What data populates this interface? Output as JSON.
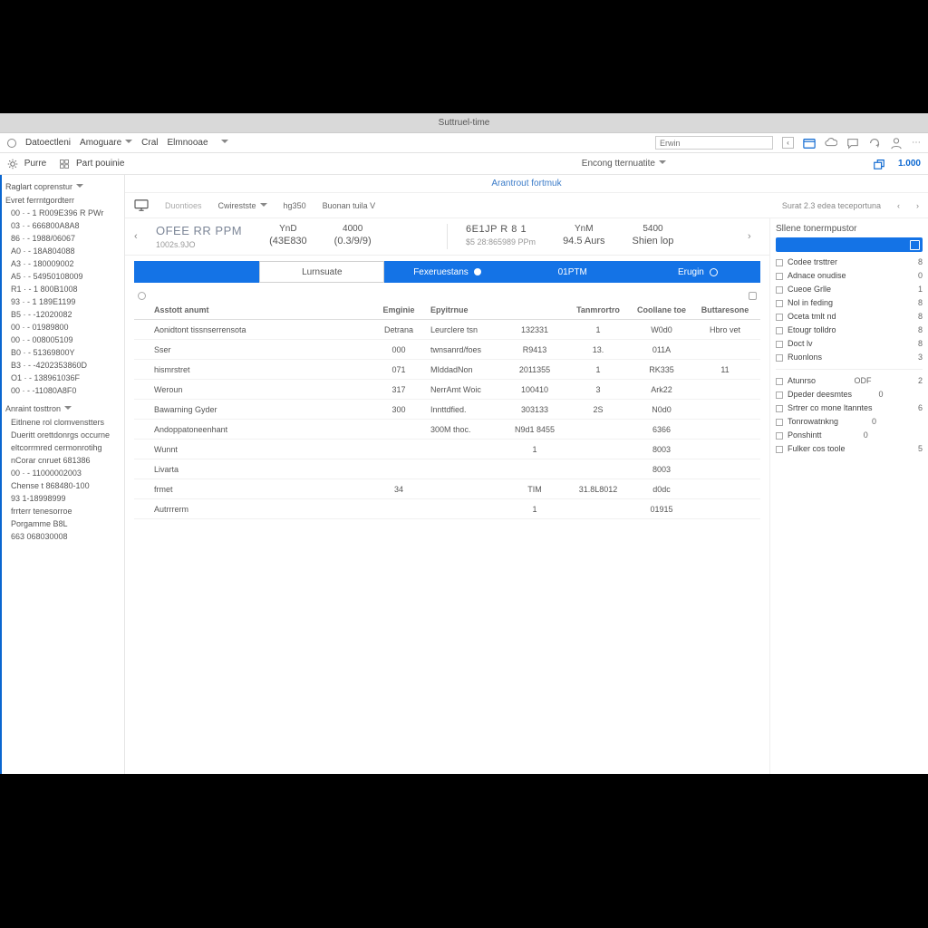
{
  "window": {
    "title": "Suttruel-time"
  },
  "menubar": {
    "items": [
      "Datoectleni",
      "Amoguare",
      "Cral",
      "Elmnooae"
    ],
    "search_placeholder": "Erwin"
  },
  "ribbon": {
    "left": [
      {
        "icon": "gear-icon",
        "label": "Purre"
      },
      {
        "icon": "grid-icon",
        "label": "Part pouinie"
      }
    ],
    "center_crumb": "Arantrout fortmuk",
    "template_label": "Encong tternuatite",
    "right_icon": "export-icon",
    "right_value": "1.000"
  },
  "sidebar": {
    "section1_title": "Raglart coprenstur",
    "tree": [
      "Evret ferrntgordterr",
      "00 · - 1 R009E396 R PWr",
      "03 · - 666800A8A8",
      "86 · - 1988/06067",
      "A0 · - 18A804088",
      "A3 · - 180009002",
      "A5 · - 54950108009",
      "R1 · - 1 800B1008",
      "93 · - 1 189E1199",
      "B5 · - -12020082",
      "00 · - 01989800",
      "00 · - 008005109",
      "B0 · - 51369800Y",
      "B3 · - -4202353860D",
      "O1 · - 138961036F",
      "00 · - -11080A8F0"
    ],
    "section2_title": "Anraint tosttron",
    "section2_items": [
      "Eitlnene rol clomvenstters",
      "Dueritt orettdonrgs occurne",
      "eltcorrmred cermonrotihg",
      "nCorar cnruet 681386",
      "00 · - 11000002003",
      "Chense t 868480-100",
      "93   1-18998999",
      "frrterr tenesorroe",
      "Porgamme B8L",
      "663 068030008"
    ]
  },
  "toolbar2": {
    "breadcrumb": "Duontioes",
    "items": [
      "Cwirestste",
      "hg350",
      "Buonan tuila   V"
    ],
    "right": "Surat 2.3 edea teceportuna"
  },
  "summary": {
    "left": {
      "title": "OFEE RR PPM",
      "sub": "1002s.9JO"
    },
    "metrics1": [
      {
        "label": "YnD",
        "value": "(43E830"
      },
      {
        "label": "4000",
        "value": "(0.3/9/9)"
      }
    ],
    "right": {
      "title": "6E1JP R 8 1",
      "sub": "$5 28:865989 PPm"
    },
    "metrics2": [
      {
        "label": "YnM",
        "value": "94.5 Aurs"
      },
      {
        "label": "5400",
        "value": "Shien lop"
      }
    ]
  },
  "tabs": [
    {
      "label": "",
      "style": "active"
    },
    {
      "label": "Lurnsuate",
      "style": "white"
    },
    {
      "label": "Fexeruestans",
      "style": "blue",
      "icon": "dot"
    },
    {
      "label": "01PTM",
      "style": "blue"
    },
    {
      "label": "Erugin",
      "style": "blue",
      "icon": "ring"
    }
  ],
  "table": {
    "columns": [
      "",
      "Asstott anumt",
      "Emginie",
      "Epyitrnue",
      "Tanmrortro",
      "Coollane toe",
      "Buttaresone"
    ],
    "rows": [
      {
        "name": "Aonidtont tissnserrensota",
        "eng": "Detrana",
        "exp": "Leurclere tsn",
        "time": "132331",
        "trm": "1",
        "cool": "W0d0",
        "bat": "Hbro vet"
      },
      {
        "name": "Sser",
        "eng": "000",
        "exp": "twnsanrd/foes",
        "time": "R9413",
        "trm": "13.",
        "cool": "011A",
        "bat": ""
      },
      {
        "name": "hismrstret",
        "eng": "071",
        "exp": "MIddadNon",
        "time": "2011355",
        "trm": "1",
        "cool": "RK335",
        "bat": "11"
      },
      {
        "name": "Weroun",
        "eng": "317",
        "exp": "NerrAmt Woic",
        "time": "100410",
        "trm": "3",
        "cool": "Ark22",
        "bat": ""
      },
      {
        "name": "Bawarning Gyder",
        "eng": "300",
        "exp": "Innttdfied.",
        "time": "303133",
        "trm": "2S",
        "cool": "N0d0",
        "bat": ""
      },
      {
        "name": "Andoppatoneenhant",
        "eng": "",
        "exp": "300M thoc.",
        "time": "N9d1 8455",
        "trm": "",
        "cool": "6366",
        "bat": ""
      },
      {
        "name": "Wunnt",
        "eng": "",
        "exp": "",
        "time": "1",
        "trm": "",
        "cool": "8003",
        "bat": ""
      },
      {
        "name": "Livarta",
        "eng": "",
        "exp": "",
        "time": "",
        "trm": "",
        "cool": "8003",
        "bat": ""
      },
      {
        "name": "frmet",
        "eng": "34",
        "exp": "",
        "time": "TIM",
        "trm": "31.8L8012",
        "cool": "d0dc",
        "bat": ""
      },
      {
        "name": "Autrrrerm",
        "eng": "",
        "exp": "",
        "time": "1",
        "trm": "",
        "cool": "01915",
        "bat": ""
      }
    ]
  },
  "rightpanel": {
    "title": "Sllene tonermpustor",
    "rows1": [
      {
        "label": "Codee trsttrer",
        "v": "8"
      },
      {
        "label": "Adnace onudise",
        "v": "0"
      },
      {
        "label": "Cueoe Grlle",
        "v": "1"
      },
      {
        "label": "Nol in feding",
        "v": "8"
      },
      {
        "label": "Oceta tmlt nd",
        "v": "8"
      },
      {
        "label": "Etougr tolldro",
        "v": "8"
      },
      {
        "label": "Doct lv",
        "v": "8"
      },
      {
        "label": "Ruonlons",
        "v": "3"
      }
    ],
    "rows2": [
      {
        "label": "Atunrso",
        "v": "ODF",
        "v2": "2"
      },
      {
        "label": "Dpeder deesmtes",
        "v": "0",
        "v2": ""
      },
      {
        "label": "Srtrer co mone ltanntes",
        "v": "",
        "v2": "6"
      },
      {
        "label": "Tonrowatnkng",
        "v": "0",
        "v2": ""
      },
      {
        "label": "Ponshintt",
        "v": "0",
        "v2": ""
      },
      {
        "label": "Fulker cos toole",
        "v": "",
        "v2": "5"
      }
    ]
  }
}
